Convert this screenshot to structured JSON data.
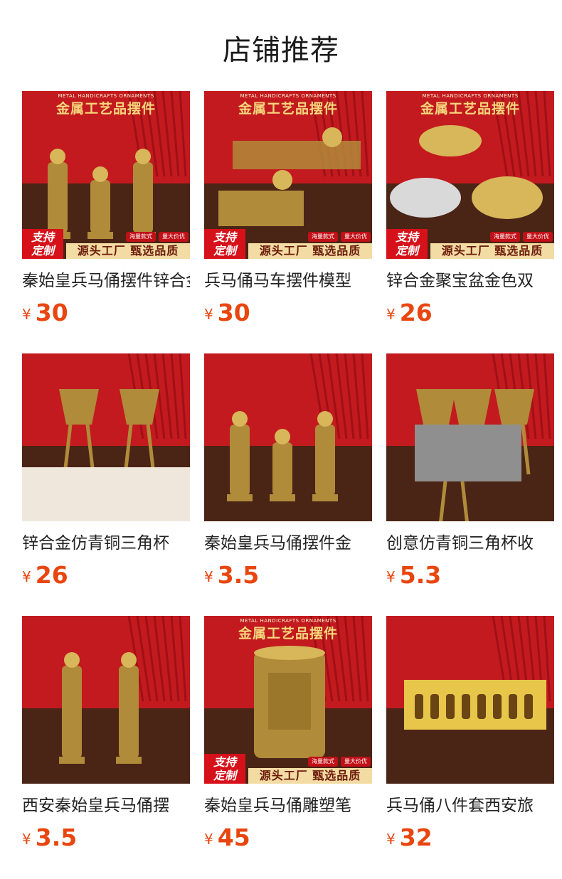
{
  "page": {
    "title": "店铺推荐"
  },
  "products": [
    {
      "name": "秦始皇兵马俑摆件锌合金",
      "price": "30",
      "currency": "¥",
      "banner": true,
      "image": "terracotta-warriors-photo",
      "bottom_strip": true
    },
    {
      "name": "兵马俑马车摆件模型",
      "price": "30",
      "currency": "¥",
      "banner": true,
      "image": "chariot-model-photo",
      "bottom_strip": true
    },
    {
      "name": "锌合金聚宝盆金色双",
      "price": "26",
      "currency": "¥",
      "banner": true,
      "image": "treasure-bowls-photo",
      "bottom_strip": true
    },
    {
      "name": "锌合金仿青铜三角杯",
      "price": "26",
      "currency": "¥",
      "banner": false,
      "image": "bronze-tripod-cups-photo",
      "bottom_strip": false
    },
    {
      "name": "秦始皇兵马俑摆件金",
      "price": "3.5",
      "currency": "¥",
      "banner": false,
      "image": "gold-warrior-figures-photo",
      "bottom_strip": false
    },
    {
      "name": "创意仿青铜三角杯收",
      "price": "5.3",
      "currency": "¥",
      "banner": false,
      "image": "bronze-jue-cups-photo",
      "bottom_strip": false
    },
    {
      "name": "西安秦始皇兵马俑摆",
      "price": "3.5",
      "currency": "¥",
      "banner": false,
      "image": "emperor-statues-photo",
      "bottom_strip": false
    },
    {
      "name": "秦始皇兵马俑雕塑笔",
      "price": "45",
      "currency": "¥",
      "banner": true,
      "image": "pen-holder-photo",
      "bottom_strip": true
    },
    {
      "name": "兵马俑八件套西安旅",
      "price": "32",
      "currency": "¥",
      "banner": false,
      "image": "eight-piece-gift-box-photo",
      "bottom_strip": false
    }
  ],
  "banner_text": {
    "sub": "METAL HANDICRAFTS ORNAMENTS",
    "main": "金属工艺品摆件",
    "badge_line1": "支持",
    "badge_line2": "定制",
    "strip": "源头工厂 甄选品质",
    "tag1": "海量款式",
    "tag2": "量大价优"
  },
  "colors": {
    "price": "#e8460f",
    "banner_red": "#c8141b",
    "gold": "#b8923a",
    "wood": "#5a2d1a"
  }
}
